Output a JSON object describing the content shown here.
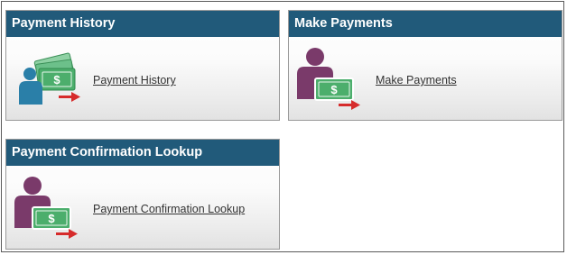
{
  "tiles": {
    "history": {
      "title": "Payment History",
      "link": "Payment History",
      "icon": "person-cash-icon"
    },
    "make": {
      "title": "Make Payments",
      "link": "Make Payments",
      "icon": "person-payment-icon"
    },
    "confirm": {
      "title": "Payment Confirmation Lookup",
      "link": "Payment Confirmation Lookup",
      "icon": "person-payment-icon"
    }
  },
  "colors": {
    "header_bg": "#215a7a",
    "person_teal": "#2a7fa8",
    "person_purple": "#7a3a6a",
    "cash_green": "#4cae6c",
    "arrow_red": "#d62b2b"
  }
}
